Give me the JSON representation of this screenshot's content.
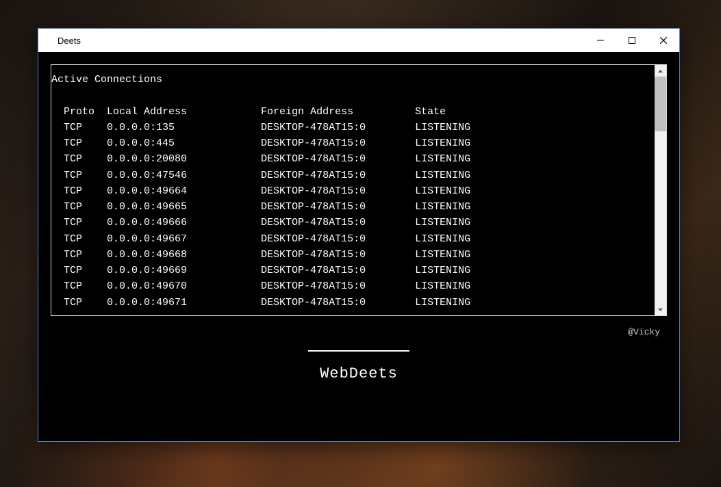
{
  "window": {
    "title": "Deets"
  },
  "terminal": {
    "header": "Active Connections",
    "columns": {
      "proto": "Proto",
      "local": "Local Address",
      "foreign": "Foreign Address",
      "state": "State"
    },
    "rows": [
      {
        "proto": "TCP",
        "local": "0.0.0.0:135",
        "foreign": "DESKTOP-478AT15:0",
        "state": "LISTENING"
      },
      {
        "proto": "TCP",
        "local": "0.0.0.0:445",
        "foreign": "DESKTOP-478AT15:0",
        "state": "LISTENING"
      },
      {
        "proto": "TCP",
        "local": "0.0.0.0:20080",
        "foreign": "DESKTOP-478AT15:0",
        "state": "LISTENING"
      },
      {
        "proto": "TCP",
        "local": "0.0.0.0:47546",
        "foreign": "DESKTOP-478AT15:0",
        "state": "LISTENING"
      },
      {
        "proto": "TCP",
        "local": "0.0.0.0:49664",
        "foreign": "DESKTOP-478AT15:0",
        "state": "LISTENING"
      },
      {
        "proto": "TCP",
        "local": "0.0.0.0:49665",
        "foreign": "DESKTOP-478AT15:0",
        "state": "LISTENING"
      },
      {
        "proto": "TCP",
        "local": "0.0.0.0:49666",
        "foreign": "DESKTOP-478AT15:0",
        "state": "LISTENING"
      },
      {
        "proto": "TCP",
        "local": "0.0.0.0:49667",
        "foreign": "DESKTOP-478AT15:0",
        "state": "LISTENING"
      },
      {
        "proto": "TCP",
        "local": "0.0.0.0:49668",
        "foreign": "DESKTOP-478AT15:0",
        "state": "LISTENING"
      },
      {
        "proto": "TCP",
        "local": "0.0.0.0:49669",
        "foreign": "DESKTOP-478AT15:0",
        "state": "LISTENING"
      },
      {
        "proto": "TCP",
        "local": "0.0.0.0:49670",
        "foreign": "DESKTOP-478AT15:0",
        "state": "LISTENING"
      },
      {
        "proto": "TCP",
        "local": "0.0.0.0:49671",
        "foreign": "DESKTOP-478AT15:0",
        "state": "LISTENING"
      }
    ]
  },
  "credit": "@Vicky",
  "brand": "WebDeets"
}
